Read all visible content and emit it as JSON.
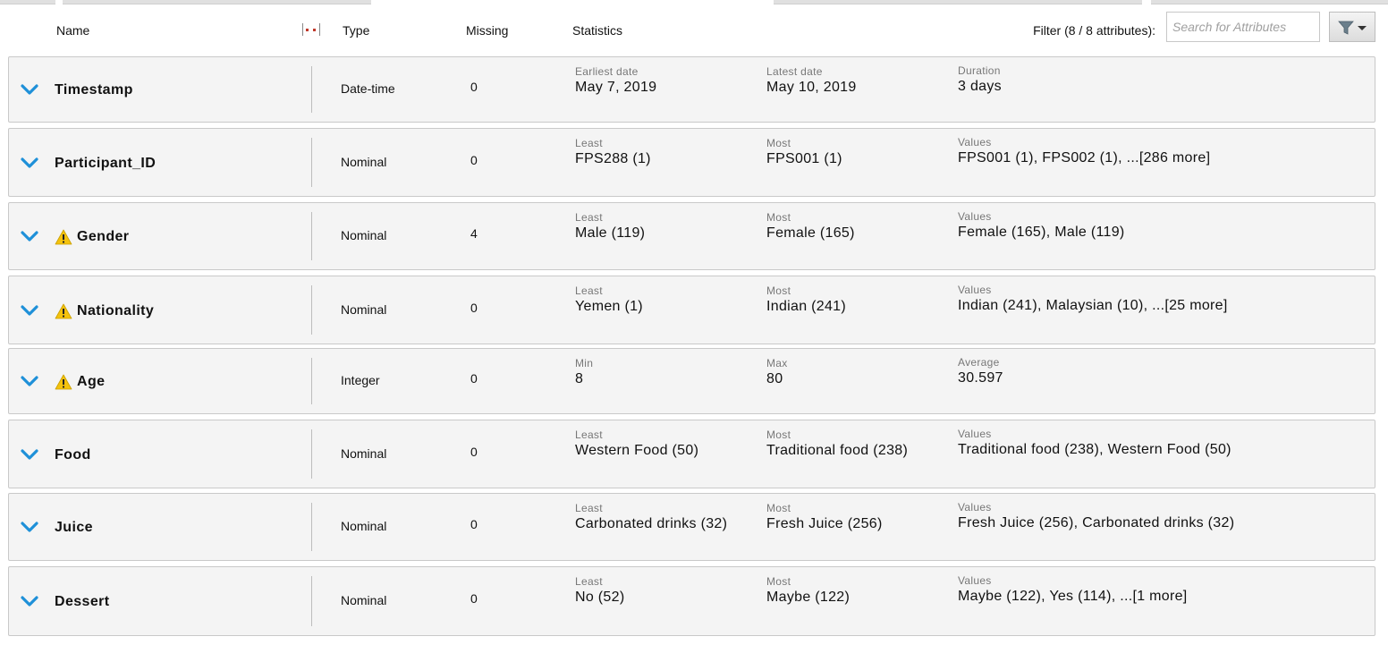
{
  "header": {
    "name": "Name",
    "type": "Type",
    "missing": "Missing",
    "statistics": "Statistics",
    "filter_label": "Filter (8 / 8 attributes):",
    "search_placeholder": "Search for Attributes"
  },
  "colors": {
    "chevron": "#1e90d8",
    "warning": "#f4c20d",
    "row_background": "#f4f4f4",
    "row_border": "#c9c9c9"
  },
  "rows": [
    {
      "name": "Timestamp",
      "warning": false,
      "type": "Date-time",
      "missing": "0",
      "stats": [
        {
          "label": "Earliest date",
          "value": "May 7, 2019"
        },
        {
          "label": "Latest date",
          "value": "May 10, 2019"
        },
        {
          "label": "Duration",
          "value": "3 days"
        }
      ]
    },
    {
      "name": "Participant_ID",
      "warning": false,
      "type": "Nominal",
      "missing": "0",
      "stats": [
        {
          "label": "Least",
          "value": "FPS288 (1)"
        },
        {
          "label": "Most",
          "value": "FPS001 (1)"
        },
        {
          "label": "Values",
          "value": "FPS001 (1), FPS002 (1), ...[286 more]"
        }
      ]
    },
    {
      "name": "Gender",
      "warning": true,
      "type": "Nominal",
      "missing": "4",
      "stats": [
        {
          "label": "Least",
          "value": "Male (119)"
        },
        {
          "label": "Most",
          "value": "Female (165)"
        },
        {
          "label": "Values",
          "value": "Female (165), Male (119)"
        }
      ]
    },
    {
      "name": "Nationality",
      "warning": true,
      "type": "Nominal",
      "missing": "0",
      "stats": [
        {
          "label": "Least",
          "value": "Yemen (1)"
        },
        {
          "label": "Most",
          "value": "Indian (241)"
        },
        {
          "label": "Values",
          "value": "Indian (241), Malaysian (10), ...[25 more]"
        }
      ]
    },
    {
      "name": "Age",
      "warning": true,
      "type": "Integer",
      "missing": "0",
      "stats": [
        {
          "label": "Min",
          "value": "8"
        },
        {
          "label": "Max",
          "value": "80"
        },
        {
          "label": "Average",
          "value": "30.597"
        }
      ]
    },
    {
      "name": "Food",
      "warning": false,
      "type": "Nominal",
      "missing": "0",
      "stats": [
        {
          "label": "Least",
          "value": "Western Food (50)"
        },
        {
          "label": "Most",
          "value": "Traditional food (238)"
        },
        {
          "label": "Values",
          "value": "Traditional food (238), Western Food (50)"
        }
      ]
    },
    {
      "name": "Juice",
      "warning": false,
      "type": "Nominal",
      "missing": "0",
      "stats": [
        {
          "label": "Least",
          "value": "Carbonated drinks (32)"
        },
        {
          "label": "Most",
          "value": "Fresh Juice (256)"
        },
        {
          "label": "Values",
          "value": "Fresh Juice (256), Carbonated drinks (32)"
        }
      ]
    },
    {
      "name": "Dessert",
      "warning": false,
      "type": "Nominal",
      "missing": "0",
      "stats": [
        {
          "label": "Least",
          "value": "No (52)"
        },
        {
          "label": "Most",
          "value": "Maybe (122)"
        },
        {
          "label": "Values",
          "value": "Maybe (122), Yes (114), ...[1 more]"
        }
      ]
    }
  ]
}
